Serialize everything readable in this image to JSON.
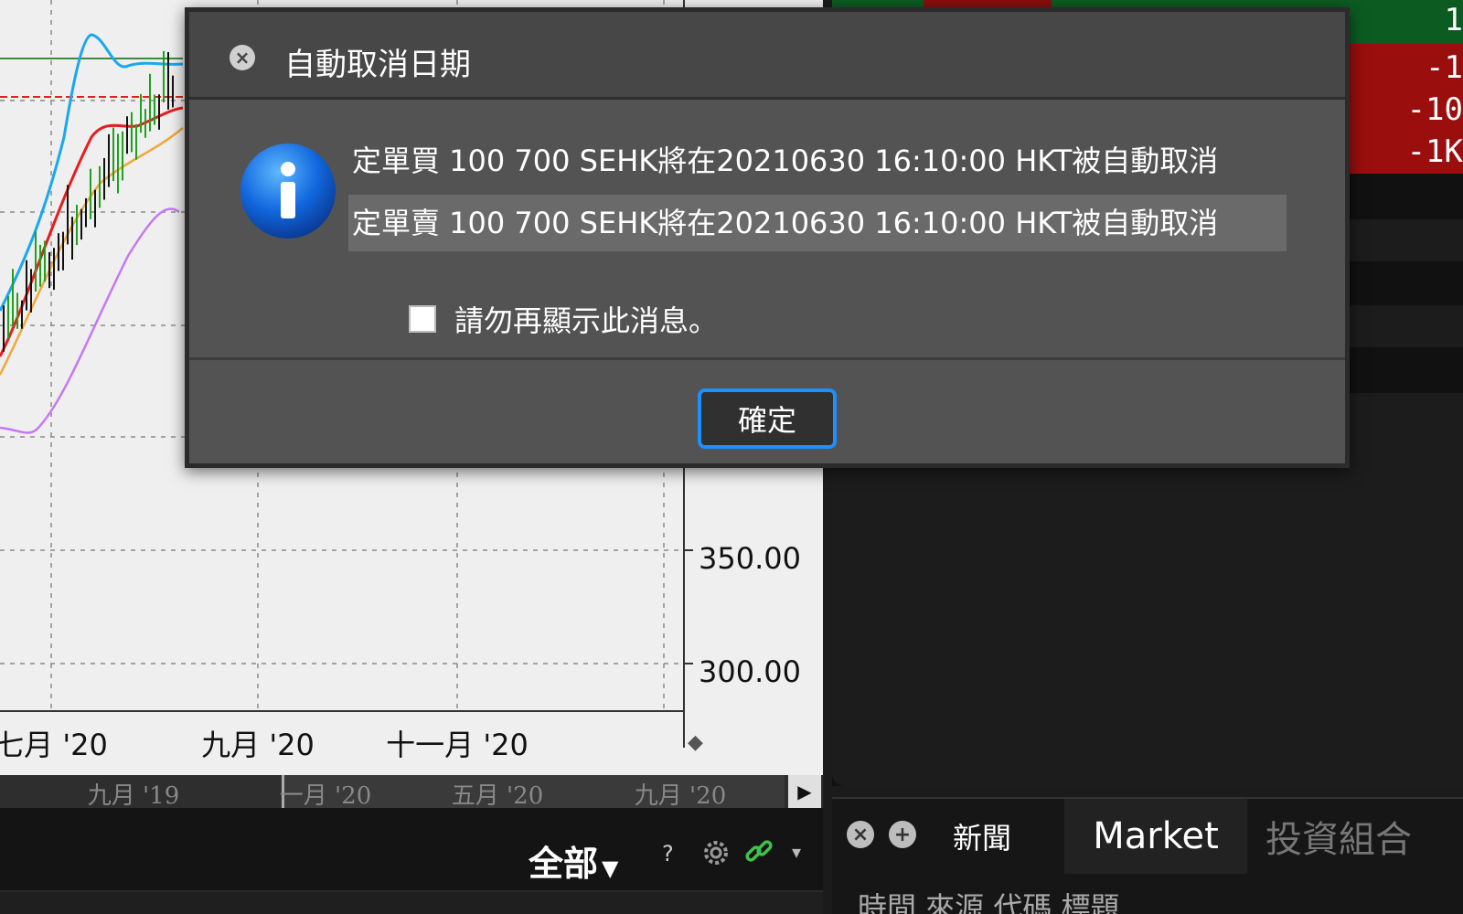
{
  "chart_data": {
    "type": "line",
    "y_ticks": [
      "350.00",
      "300.00"
    ],
    "x_ticks": [
      "七月 '20",
      "九月 '20",
      "十一月 '20"
    ],
    "navigator_ticks": [
      "九月 '19",
      "一月 '20",
      "五月 '20",
      "九月 '20"
    ],
    "series_colors": {
      "price": "#20a020",
      "upper_band": "#18a8f0",
      "ma_short": "#e81c1c",
      "ma_long": "#f0a838",
      "lower_band": "#c478f4"
    }
  },
  "right_panel": {
    "values": [
      "1",
      "-1",
      "-10",
      "-1K"
    ]
  },
  "toolbar": {
    "filter_label": "全部",
    "help_label": "?",
    "caret": "▾"
  },
  "news": {
    "tabs": {
      "news": "新聞",
      "market": "Market",
      "portfolio": "投資組合"
    },
    "headers": "時間  來源  代碼  標題"
  },
  "dialog": {
    "title": "自動取消日期",
    "messages": [
      "定單買 100 700 SEHK將在20210630 16:10:00 HKT被自動取消",
      "定單賣 100 700 SEHK將在20210630 16:10:00 HKT被自動取消"
    ],
    "dont_show_label": "請勿再顯示此消息。",
    "confirm_label": "確定"
  }
}
